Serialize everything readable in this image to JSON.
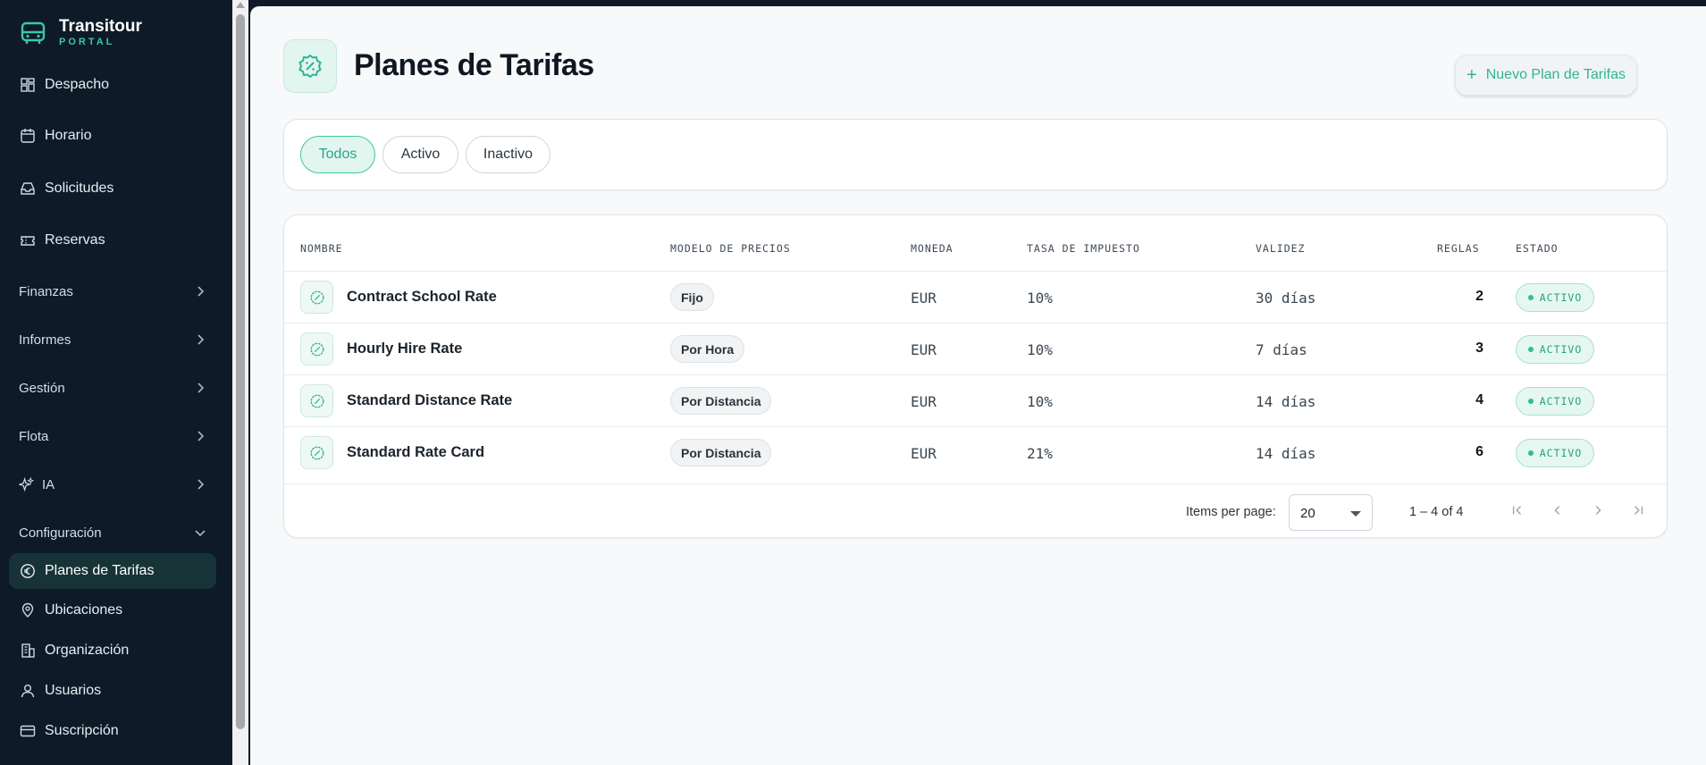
{
  "brand": {
    "name": "Transitour",
    "sub": "PORTAL"
  },
  "sidebar": {
    "items": [
      {
        "label": "Despacho",
        "icon": "grid-icon"
      },
      {
        "label": "Horario",
        "icon": "calendar-icon"
      },
      {
        "label": "Solicitudes",
        "icon": "inbox-icon"
      },
      {
        "label": "Reservas",
        "icon": "ticket-icon"
      }
    ],
    "groups": [
      {
        "label": "Finanzas"
      },
      {
        "label": "Informes"
      },
      {
        "label": "Gestión"
      },
      {
        "label": "Flota"
      },
      {
        "label": "IA"
      },
      {
        "label": "Configuración"
      }
    ],
    "config_items": [
      {
        "label": "Planes de Tarifas",
        "icon": "euro-icon"
      },
      {
        "label": "Ubicaciones",
        "icon": "map-pin-icon"
      },
      {
        "label": "Organización",
        "icon": "building-icon"
      },
      {
        "label": "Usuarios",
        "icon": "user-icon"
      },
      {
        "label": "Suscripción",
        "icon": "credit-card-icon"
      }
    ]
  },
  "header": {
    "title": "Planes de Tarifas",
    "new_button": "Nuevo Plan de Tarifas"
  },
  "filters": [
    "Todos",
    "Activo",
    "Inactivo"
  ],
  "table": {
    "columns": [
      "NOMBRE",
      "MODELO DE PRECIOS",
      "MONEDA",
      "TASA DE IMPUESTO",
      "VALIDEZ",
      "REGLAS",
      "ESTADO"
    ],
    "rows": [
      {
        "name": "Contract School Rate",
        "model": "Fijo",
        "currency": "EUR",
        "tax": "10%",
        "validity": "30 días",
        "rules": "2",
        "status": "ACTIVO"
      },
      {
        "name": "Hourly Hire Rate",
        "model": "Por Hora",
        "currency": "EUR",
        "tax": "10%",
        "validity": "7 días",
        "rules": "3",
        "status": "ACTIVO"
      },
      {
        "name": "Standard Distance Rate",
        "model": "Por Distancia",
        "currency": "EUR",
        "tax": "10%",
        "validity": "14 días",
        "rules": "4",
        "status": "ACTIVO"
      },
      {
        "name": "Standard Rate Card",
        "model": "Por Distancia",
        "currency": "EUR",
        "tax": "21%",
        "validity": "14 días",
        "rules": "6",
        "status": "ACTIVO"
      }
    ]
  },
  "pagination": {
    "label": "Items per page:",
    "per_page": "20",
    "range": "1 – 4 of 4"
  },
  "colors": {
    "accent": "#2fb592",
    "sidebar_bg": "#0e1a27",
    "active_bg": "#173338"
  }
}
